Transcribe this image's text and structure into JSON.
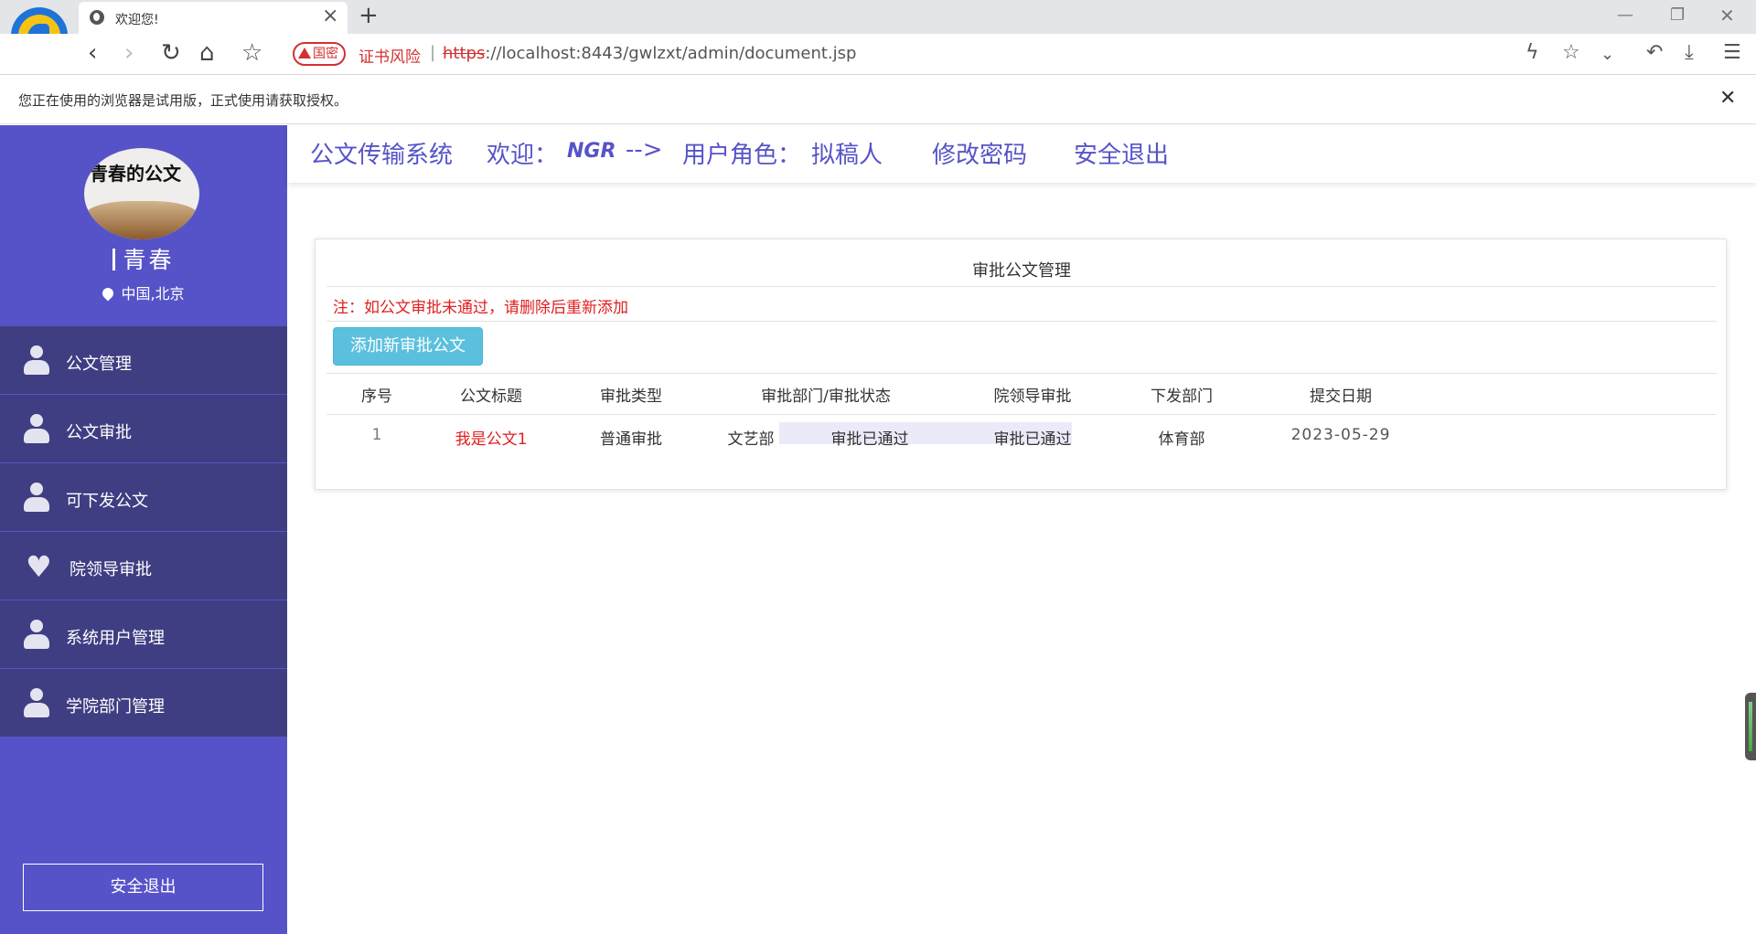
{
  "browser": {
    "tab_title": "欢迎您!",
    "security_badge": "国密",
    "cert_warning": "证书风险",
    "url_scheme": "https",
    "url_rest": "://localhost:8443/gwlzxt/admin/document.jsp",
    "notice": "您正在使用的浏览器是试用版，正式使用请获取授权。"
  },
  "sidebar": {
    "avatar_text": "青春的公文",
    "user_name": "青春",
    "location": "中国,北京",
    "items": [
      {
        "label": "公文管理",
        "icon": "person-icon"
      },
      {
        "label": "公文审批",
        "icon": "person-icon"
      },
      {
        "label": "可下发公文",
        "icon": "person-icon"
      },
      {
        "label": "院领导审批",
        "icon": "heart-icon"
      },
      {
        "label": "系统用户管理",
        "icon": "person-icon"
      },
      {
        "label": "学院部门管理",
        "icon": "person-icon"
      }
    ],
    "logout": "安全退出"
  },
  "header": {
    "system_name": "公文传输系统",
    "welcome": "欢迎：",
    "username": "NGR",
    "arrow": "-->",
    "role_label": "用户角色：",
    "role_value": "拟稿人",
    "change_password": "修改密码",
    "logout": "安全退出"
  },
  "panel": {
    "title": "审批公文管理",
    "note": "注：如公文审批未通过，请删除后重新添加",
    "add_button": "添加新审批公文",
    "columns": [
      "序号",
      "公文标题",
      "审批类型",
      "审批部门/审批状态",
      "院领导审批",
      "下发部门",
      "提交日期"
    ],
    "rows": [
      {
        "index": "1",
        "title": "我是公文1",
        "type": "普通审批",
        "dept": "文艺部",
        "dept_status": "审批已通过",
        "leader_status": "审批已通过",
        "issue_dept": "体育部",
        "date": "2023-05-29"
      }
    ]
  },
  "colors": {
    "sidebar_bg": "#5653c8",
    "menu_bg": "#403e82",
    "accent_text": "#5653c8",
    "note_red": "#e02020",
    "add_button": "#5bc0de"
  }
}
